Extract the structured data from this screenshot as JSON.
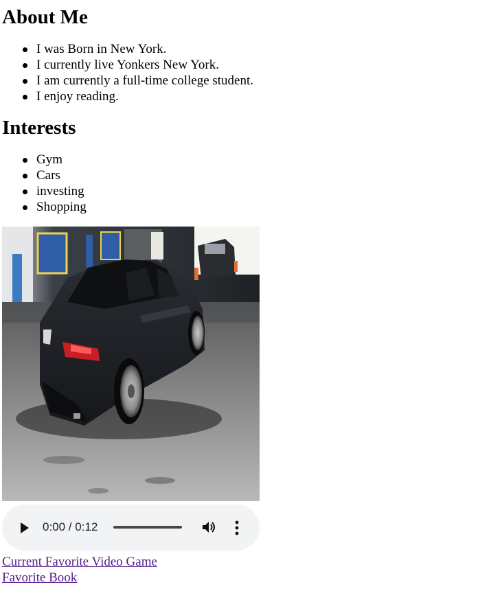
{
  "about": {
    "heading": "About Me",
    "items": [
      "I was Born in New York.",
      "I currently live Yonkers New York.",
      "I am currently a full-time college student.",
      "I enjoy reading."
    ]
  },
  "interests": {
    "heading": "Interests",
    "items": [
      "Gym",
      "Cars",
      "investing",
      "Shopping"
    ]
  },
  "photo": {
    "subject": "dark sedan parked in a garage"
  },
  "audio": {
    "time": "0:00 / 0:12",
    "play_icon": "play-icon",
    "volume_icon": "volume-icon",
    "more_icon": "more-options-icon"
  },
  "links": {
    "video_game": "Current Favorite Video Game",
    "book": "Favorite Book"
  },
  "colors": {
    "link": "#551a8b",
    "player_bg": "#f1f3f4"
  }
}
